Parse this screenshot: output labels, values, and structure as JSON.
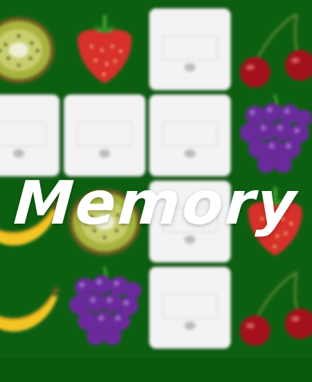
{
  "game": {
    "title": "Memory",
    "status_text": "",
    "card_back_label": "",
    "colors": {
      "board": "#0c5f11",
      "card_back": "#f3f3f3",
      "title": "#ffffff"
    }
  },
  "board": {
    "columns": 4,
    "rows": 4,
    "cards": [
      {
        "state": "face-up",
        "fruit": "kiwi"
      },
      {
        "state": "face-up",
        "fruit": "strawberry"
      },
      {
        "state": "face-down",
        "fruit": ""
      },
      {
        "state": "face-up",
        "fruit": "cherries"
      },
      {
        "state": "face-down",
        "fruit": ""
      },
      {
        "state": "face-down",
        "fruit": ""
      },
      {
        "state": "face-down",
        "fruit": ""
      },
      {
        "state": "face-up",
        "fruit": "grapes"
      },
      {
        "state": "face-up",
        "fruit": "banana"
      },
      {
        "state": "face-up",
        "fruit": "kiwi"
      },
      {
        "state": "face-down",
        "fruit": ""
      },
      {
        "state": "face-up",
        "fruit": "strawberry"
      },
      {
        "state": "face-up",
        "fruit": "banana"
      },
      {
        "state": "face-up",
        "fruit": "grapes"
      },
      {
        "state": "face-down",
        "fruit": ""
      },
      {
        "state": "face-up",
        "fruit": "cherries"
      }
    ]
  }
}
